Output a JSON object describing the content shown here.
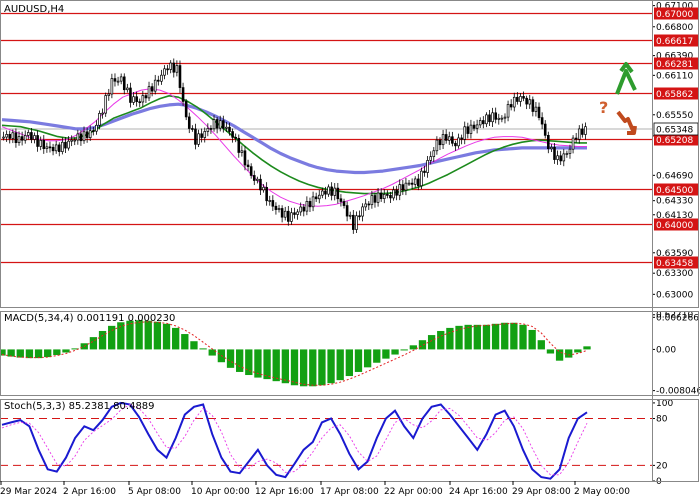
{
  "chart_data": [
    {
      "type": "candlestick",
      "title": "AUDUSD,H4",
      "ylim": [
        0.6282,
        0.6718
      ],
      "y_ticks": [
        "0.67100",
        "0.66800",
        "0.66390",
        "0.66110",
        "0.65550",
        "0.65250",
        "0.64690",
        "0.64330",
        "0.64130",
        "0.63590",
        "0.63300",
        "0.63000",
        "0.62710"
      ],
      "levels": [
        "0.67000",
        "0.66617",
        "0.66281",
        "0.65862",
        "0.65208",
        "0.64500",
        "0.64000",
        "0.63458"
      ],
      "current_price": "0.65348",
      "x_labels": [
        "29 Mar 2024",
        "2 Apr 16:00",
        "5 Apr 08:00",
        "10 Apr 00:00",
        "12 Apr 16:00",
        "17 Apr 08:00",
        "22 Apr 00:00",
        "24 Apr 16:00",
        "29 Apr 08:00",
        "2 May 00:00"
      ],
      "close_series": [
        0.6522,
        0.6526,
        0.6519,
        0.6528,
        0.6516,
        0.6508,
        0.6507,
        0.6512,
        0.6522,
        0.6525,
        0.6532,
        0.6563,
        0.6603,
        0.6605,
        0.6578,
        0.6574,
        0.6589,
        0.6605,
        0.6624,
        0.662,
        0.655,
        0.6519,
        0.653,
        0.6543,
        0.654,
        0.6526,
        0.6498,
        0.6469,
        0.6454,
        0.643,
        0.6418,
        0.6409,
        0.6418,
        0.6426,
        0.6438,
        0.6447,
        0.6446,
        0.6424,
        0.6398,
        0.6423,
        0.6435,
        0.644,
        0.644,
        0.645,
        0.6458,
        0.646,
        0.6487,
        0.6515,
        0.6524,
        0.6512,
        0.6532,
        0.6538,
        0.6547,
        0.6553,
        0.6548,
        0.6572,
        0.658,
        0.6571,
        0.6555,
        0.651,
        0.6491,
        0.65,
        0.6526,
        0.6535
      ],
      "ma_fast": [
        0.6538,
        0.6533,
        0.6528,
        0.6523,
        0.652,
        0.6518,
        0.6518,
        0.652,
        0.6526,
        0.6535,
        0.6545,
        0.6558,
        0.657,
        0.658,
        0.6585,
        0.659,
        0.6592,
        0.659,
        0.6585,
        0.6576,
        0.6565,
        0.6553,
        0.654,
        0.6526,
        0.6511,
        0.6496,
        0.6482,
        0.6468,
        0.6456,
        0.6446,
        0.6438,
        0.6432,
        0.6428,
        0.6426,
        0.6425,
        0.6426,
        0.6428,
        0.6432,
        0.6436,
        0.644,
        0.6445,
        0.645,
        0.6456,
        0.6463,
        0.647,
        0.6477,
        0.6485,
        0.6492,
        0.6499,
        0.6505,
        0.6511,
        0.6516,
        0.652,
        0.6523,
        0.6524,
        0.6524,
        0.6523,
        0.652,
        0.6517,
        0.6514,
        0.6512,
        0.6511,
        0.651,
        0.651
      ],
      "ma_mid": [
        0.654,
        0.6539,
        0.6538,
        0.6535,
        0.6532,
        0.6528,
        0.6524,
        0.6522,
        0.6522,
        0.6526,
        0.6533,
        0.6542,
        0.655,
        0.6555,
        0.656,
        0.6565,
        0.6572,
        0.6578,
        0.6582,
        0.658,
        0.6574,
        0.6566,
        0.6556,
        0.6545,
        0.6534,
        0.6523,
        0.6512,
        0.6501,
        0.6491,
        0.6482,
        0.6474,
        0.6467,
        0.6461,
        0.6456,
        0.6452,
        0.6449,
        0.6447,
        0.6445,
        0.6444,
        0.6443,
        0.6443,
        0.6443,
        0.6444,
        0.6446,
        0.6449,
        0.6453,
        0.6458,
        0.6464,
        0.647,
        0.6477,
        0.6484,
        0.6491,
        0.6498,
        0.6504,
        0.6509,
        0.6513,
        0.6516,
        0.6518,
        0.6519,
        0.6518,
        0.6517,
        0.6516,
        0.6515,
        0.6515
      ],
      "ma_slow": [
        0.6548,
        0.6547,
        0.6546,
        0.6545,
        0.6543,
        0.6541,
        0.6539,
        0.6537,
        0.6535,
        0.6535,
        0.6537,
        0.6541,
        0.6546,
        0.6551,
        0.6556,
        0.656,
        0.6564,
        0.6567,
        0.6569,
        0.657,
        0.6568,
        0.6564,
        0.6559,
        0.6553,
        0.6546,
        0.6539,
        0.6531,
        0.6523,
        0.6515,
        0.6507,
        0.65,
        0.6494,
        0.6489,
        0.6484,
        0.648,
        0.6477,
        0.6475,
        0.6474,
        0.6473,
        0.6473,
        0.6474,
        0.6475,
        0.6477,
        0.6479,
        0.6481,
        0.6483,
        0.6486,
        0.6489,
        0.6492,
        0.6495,
        0.6498,
        0.6501,
        0.6503,
        0.6505,
        0.6506,
        0.6507,
        0.6508,
        0.6508,
        0.6508,
        0.6508,
        0.6508,
        0.6508,
        0.6508,
        0.6508
      ]
    },
    {
      "type": "bar",
      "title": "MACD(5,34,4) 0.001191 0.000230",
      "ylim": [
        -0.0089,
        0.0075
      ],
      "y_ticks": [
        "0.006266",
        "0.00",
        "-0.008046"
      ],
      "values": [
        -0.0012,
        -0.0014,
        -0.0016,
        -0.0017,
        -0.0017,
        -0.0015,
        -0.0011,
        -0.0006,
        0.0002,
        0.0012,
        0.0024,
        0.0036,
        0.0046,
        0.0053,
        0.0056,
        0.0057,
        0.0056,
        0.0054,
        0.005,
        0.0042,
        0.003,
        0.0016,
        0.0002,
        -0.0012,
        -0.0025,
        -0.0036,
        -0.0044,
        -0.005,
        -0.0055,
        -0.0058,
        -0.0062,
        -0.0066,
        -0.007,
        -0.0072,
        -0.0072,
        -0.007,
        -0.0066,
        -0.006,
        -0.0052,
        -0.0044,
        -0.0035,
        -0.0026,
        -0.0018,
        -0.001,
        -0.0002,
        0.0008,
        0.0018,
        0.0028,
        0.0036,
        0.0042,
        0.0046,
        0.0048,
        0.0048,
        0.0048,
        0.005,
        0.0052,
        0.0052,
        0.0048,
        0.0038,
        0.0018,
        -0.0008,
        -0.0022,
        -0.0016,
        -0.0006,
        0.0006
      ],
      "signal": [
        -0.001,
        -0.0013,
        -0.0015,
        -0.0016,
        -0.0016,
        -0.0015,
        -0.0012,
        -0.0008,
        -0.0002,
        0.0006,
        0.0016,
        0.0027,
        0.0037,
        0.0045,
        0.005,
        0.0053,
        0.0054,
        0.0053,
        0.0051,
        0.0046,
        0.0038,
        0.0027,
        0.0014,
        0.0001,
        -0.0012,
        -0.0023,
        -0.0033,
        -0.0041,
        -0.0047,
        -0.0052,
        -0.0056,
        -0.006,
        -0.0064,
        -0.0068,
        -0.007,
        -0.007,
        -0.0068,
        -0.0064,
        -0.0058,
        -0.0051,
        -0.0043,
        -0.0035,
        -0.0027,
        -0.0019,
        -0.0011,
        -0.0002,
        0.0008,
        0.0017,
        0.0026,
        0.0033,
        0.0039,
        0.0043,
        0.0046,
        0.0047,
        0.0048,
        0.005,
        0.0051,
        0.005,
        0.0045,
        0.0032,
        0.0012,
        -0.0005,
        -0.0011,
        -0.0008,
        -0.0002
      ]
    },
    {
      "type": "line",
      "title": "Stoch(5,3,3) 85.2381 80.4889",
      "ylim": [
        0,
        105
      ],
      "y_ticks": [
        "100",
        "80",
        "20",
        "0"
      ],
      "levels": [
        80,
        20
      ],
      "series": [
        {
          "values": [
            72,
            75,
            78,
            70,
            40,
            15,
            12,
            30,
            55,
            70,
            65,
            78,
            95,
            100,
            98,
            82,
            60,
            40,
            30,
            55,
            85,
            95,
            98,
            60,
            30,
            12,
            10,
            25,
            40,
            20,
            8,
            5,
            22,
            40,
            50,
            75,
            80,
            60,
            35,
            15,
            25,
            55,
            80,
            90,
            70,
            55,
            80,
            95,
            98,
            85,
            70,
            55,
            40,
            60,
            85,
            90,
            70,
            40,
            15,
            5,
            3,
            15,
            55,
            80,
            88
          ]
        },
        {
          "values": [
            68,
            72,
            75,
            74,
            62,
            42,
            22,
            19,
            32,
            52,
            63,
            71,
            79,
            91,
            98,
            93,
            80,
            61,
            43,
            42,
            57,
            78,
            93,
            84,
            63,
            34,
            17,
            16,
            25,
            28,
            23,
            11,
            12,
            22,
            37,
            55,
            68,
            72,
            58,
            37,
            25,
            32,
            53,
            75,
            80,
            72,
            68,
            77,
            91,
            93,
            84,
            70,
            55,
            52,
            62,
            78,
            82,
            67,
            42,
            20,
            8,
            8,
            24,
            50,
            74
          ]
        }
      ]
    }
  ]
}
